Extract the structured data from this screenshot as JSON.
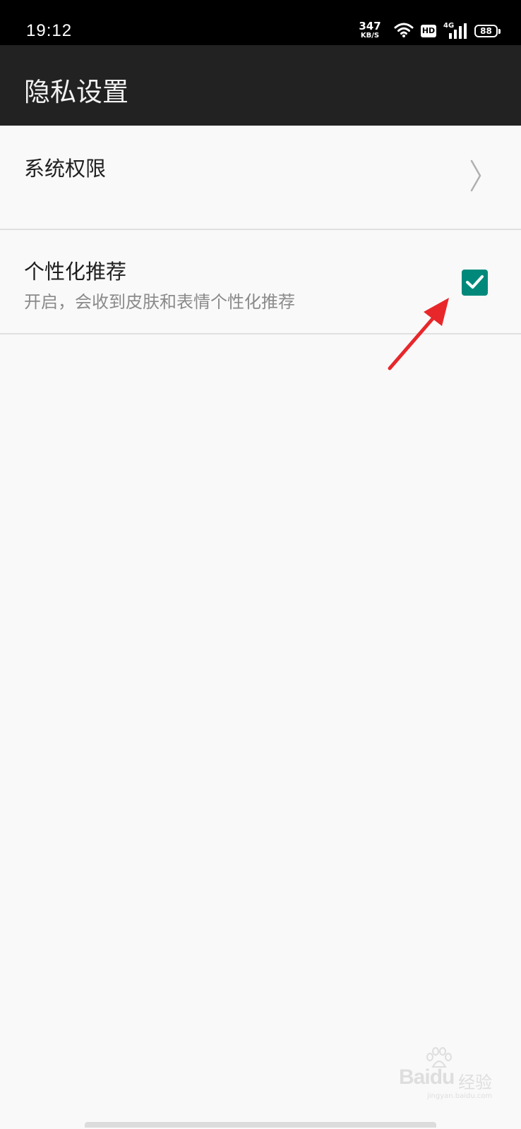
{
  "status_bar": {
    "time": "19:12",
    "net_speed_value": "347",
    "net_speed_unit": "KB/S",
    "hd_label": "HD",
    "signal_label": "4G",
    "battery_level": "88"
  },
  "header": {
    "title": "隐私设置"
  },
  "settings": {
    "items": [
      {
        "title": "系统权限",
        "icon": "chevron-right-icon"
      },
      {
        "title": "个性化推荐",
        "subtitle": "开启，会收到皮肤和表情个性化推荐",
        "checked": true,
        "icon": "check-icon"
      }
    ]
  },
  "watermark": {
    "brand": "Bai",
    "brand_suffix": "du",
    "label": "经验",
    "url": "jingyan.baidu.com"
  },
  "colors": {
    "status_bar_bg": "#000000",
    "app_bar_bg": "#222222",
    "page_bg": "#f9f9f9",
    "checkbox_accent": "#00897b",
    "annotation_arrow": "#e8272b"
  }
}
